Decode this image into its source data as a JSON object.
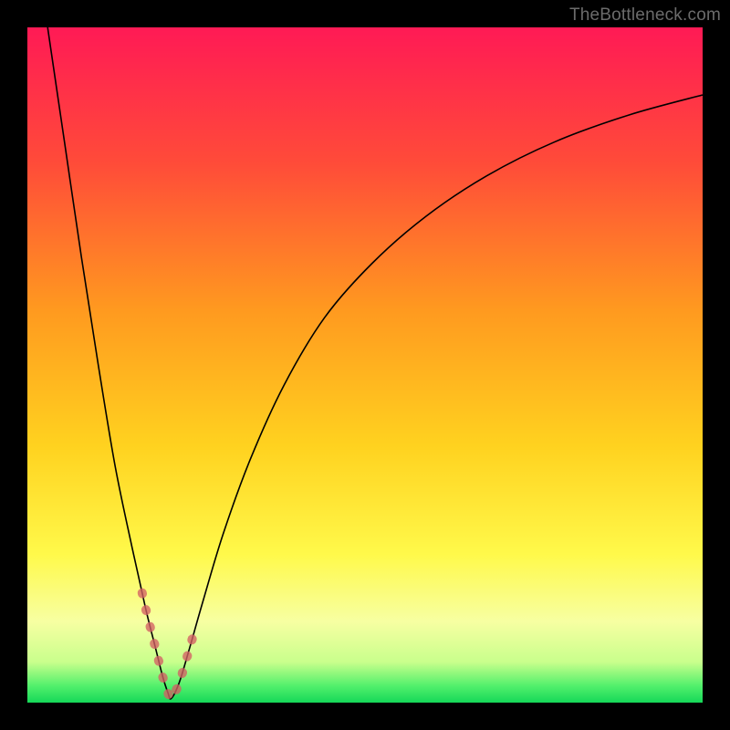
{
  "watermark": {
    "text": "TheBottleneck.com"
  },
  "chart_data": {
    "type": "line",
    "title": "",
    "xlabel": "",
    "ylabel": "",
    "xlim": [
      0,
      100
    ],
    "ylim": [
      0,
      100
    ],
    "grid": false,
    "legend": false,
    "highlightBand": {
      "xRange": [
        17,
        25
      ],
      "color": "#d36064"
    },
    "gradientStops": [
      {
        "offset": 0.0,
        "color": "#ff1a55"
      },
      {
        "offset": 0.2,
        "color": "#ff4b39"
      },
      {
        "offset": 0.42,
        "color": "#ff9a1f"
      },
      {
        "offset": 0.62,
        "color": "#ffd21f"
      },
      {
        "offset": 0.78,
        "color": "#fff94a"
      },
      {
        "offset": 0.88,
        "color": "#f7ffa2"
      },
      {
        "offset": 0.94,
        "color": "#c9ff8c"
      },
      {
        "offset": 0.975,
        "color": "#53f06c"
      },
      {
        "offset": 1.0,
        "color": "#15d858"
      }
    ],
    "series": [
      {
        "name": "left-branch",
        "x": [
          3,
          5.5,
          8,
          10.5,
          13,
          15.5,
          17.5,
          19,
          20,
          20.8,
          21.3
        ],
        "y": [
          100,
          83,
          66,
          50,
          35,
          23,
          14,
          8,
          4,
          1.5,
          0.6
        ]
      },
      {
        "name": "right-branch",
        "x": [
          21.3,
          22.5,
          24,
          26,
          29,
          33,
          38,
          44,
          51,
          59,
          68,
          78,
          89,
          100
        ],
        "y": [
          0.6,
          3,
          8,
          15,
          25,
          36,
          47,
          57,
          65,
          72,
          78,
          83,
          87,
          90
        ]
      }
    ]
  }
}
